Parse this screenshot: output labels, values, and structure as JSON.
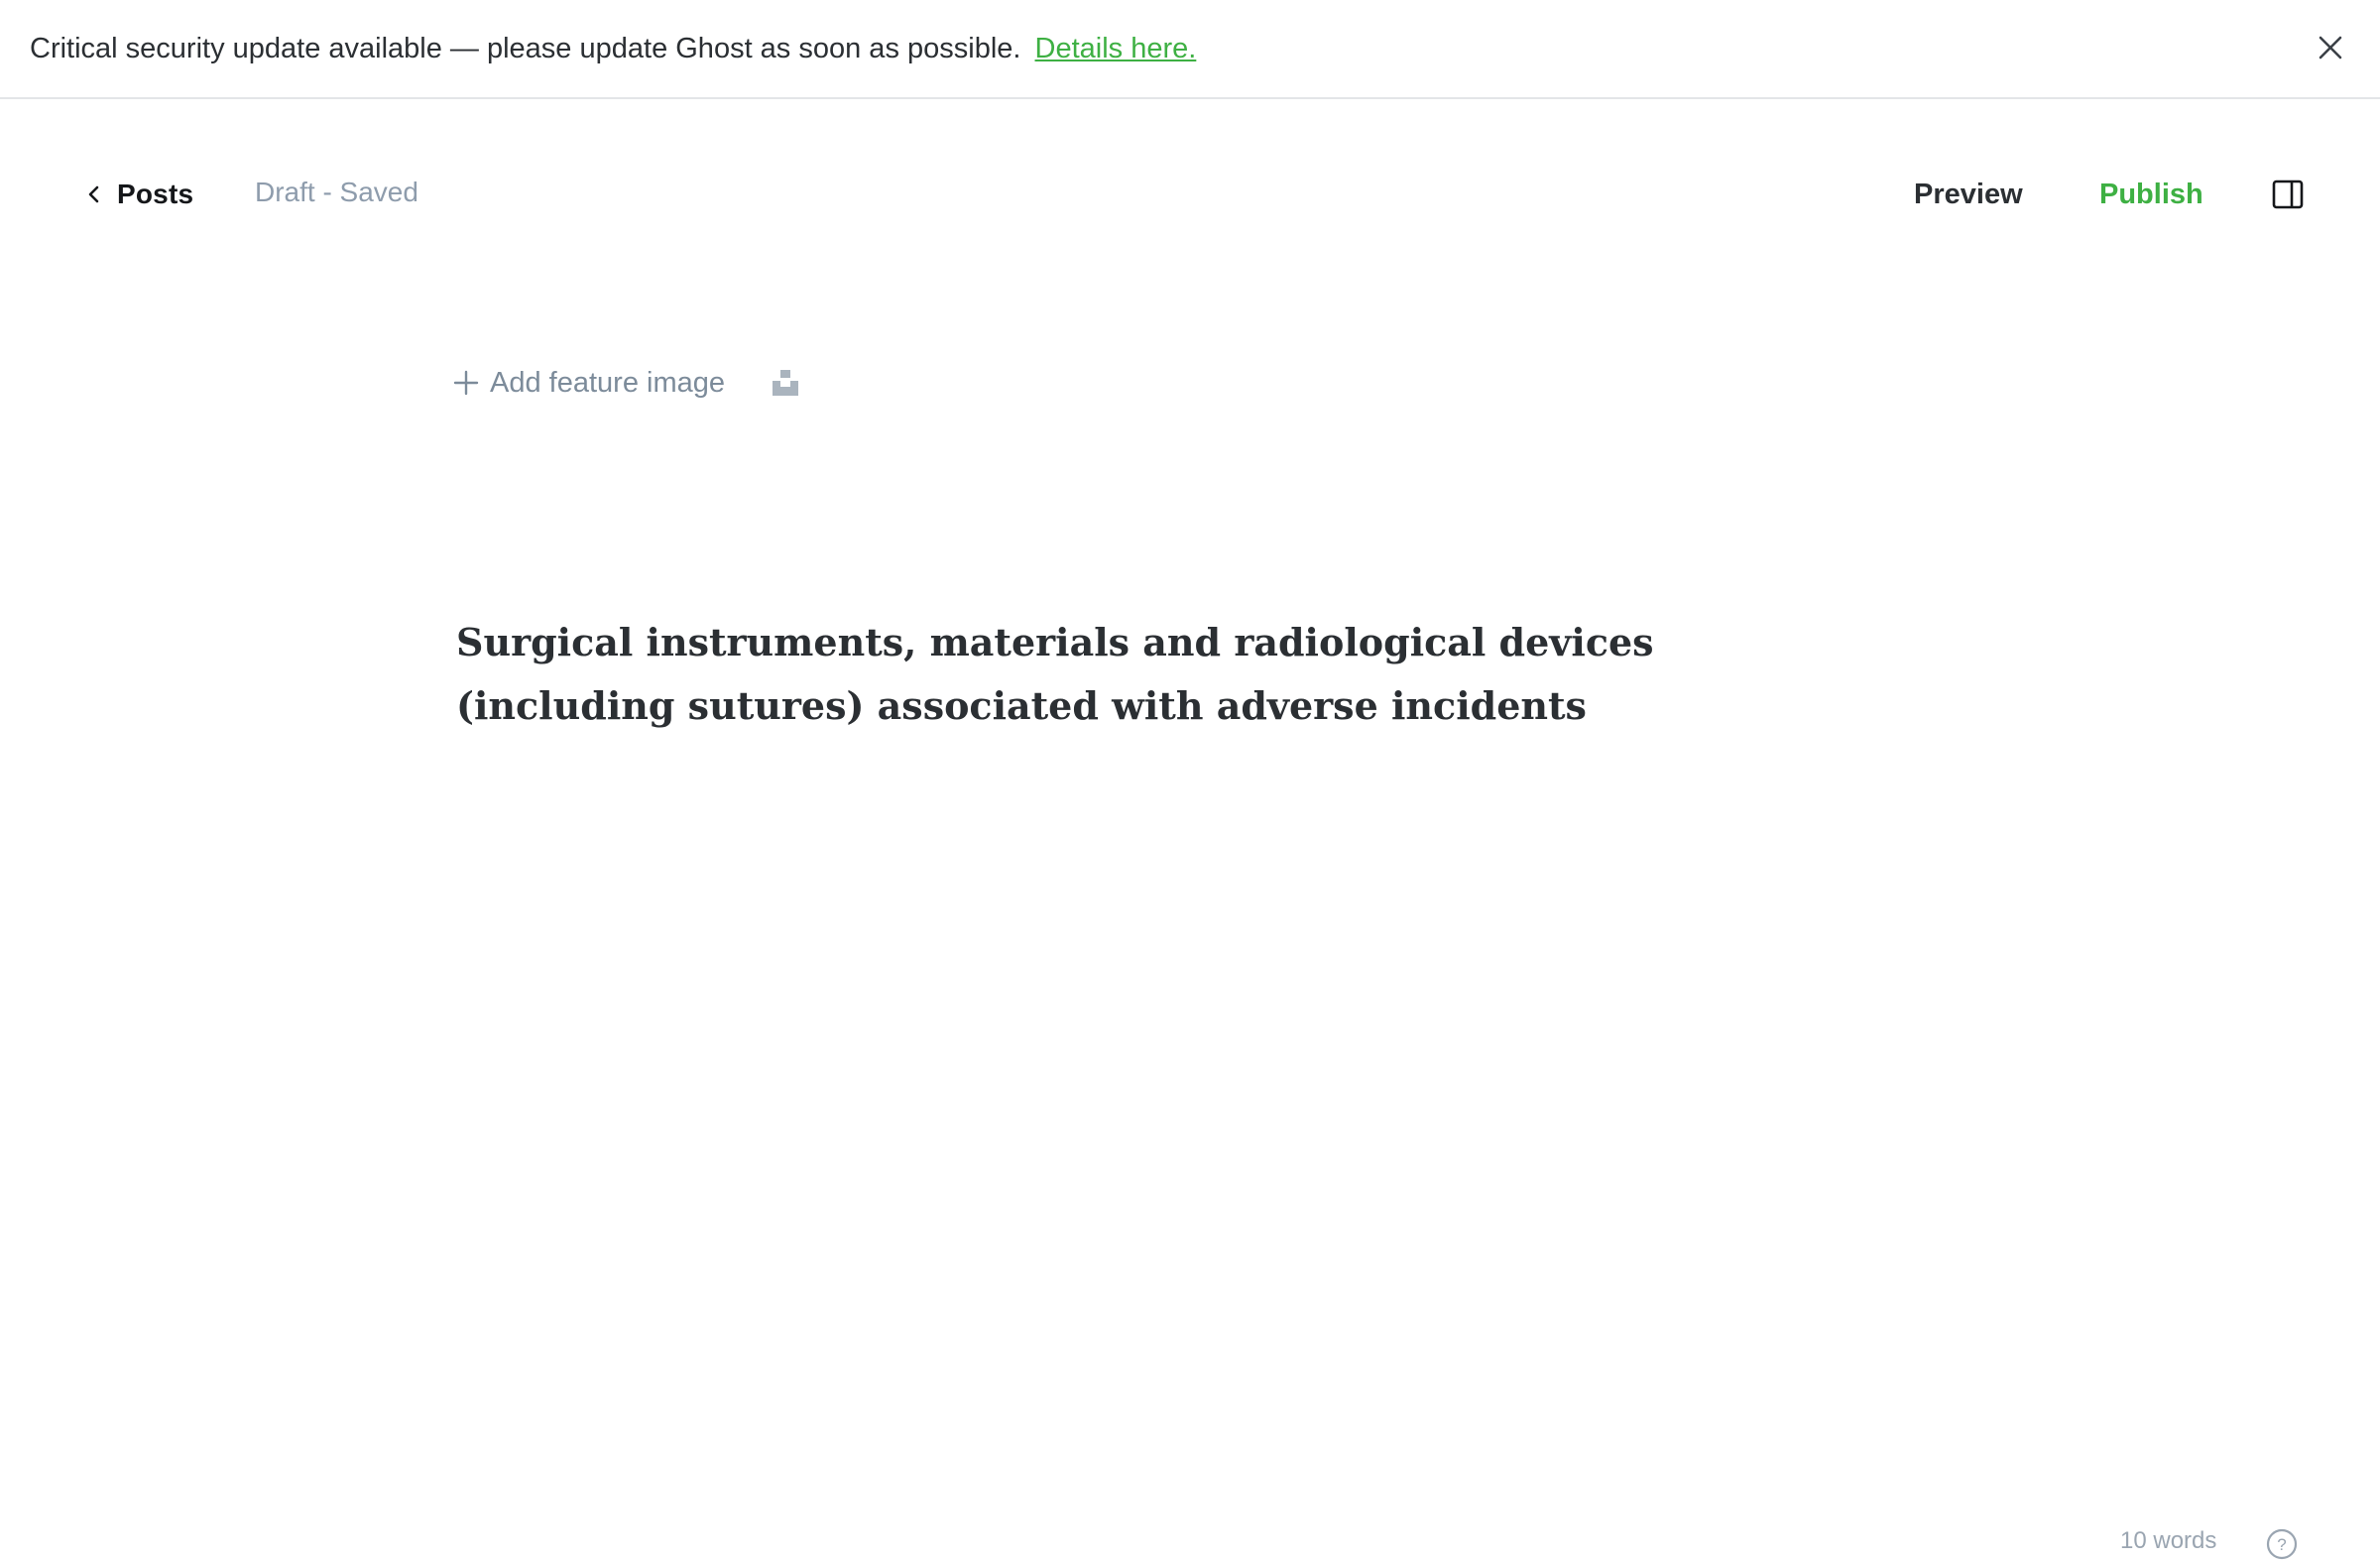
{
  "banner": {
    "message": "Critical security update available — please update Ghost as soon as possible.",
    "link_label": "Details here.",
    "close_icon": "close-icon"
  },
  "header": {
    "back_label": "Posts",
    "back_icon": "chevron-left-icon",
    "status": "Draft - Saved",
    "preview_label": "Preview",
    "publish_label": "Publish",
    "settings_icon": "sidebar-toggle-icon"
  },
  "feature_image": {
    "add_label": "Add feature image",
    "plus_icon": "plus-icon",
    "unsplash_icon": "unsplash-icon"
  },
  "post": {
    "title": "Surgical instruments, materials and radiological devices (including sutures) associated with adverse incidents"
  },
  "footer": {
    "word_count": "10 words",
    "help_icon": "help-icon"
  },
  "colors": {
    "accent": "#3eb043",
    "muted": "#8e9cac",
    "text": "#2b2f33",
    "divider": "#e3e5e8"
  }
}
